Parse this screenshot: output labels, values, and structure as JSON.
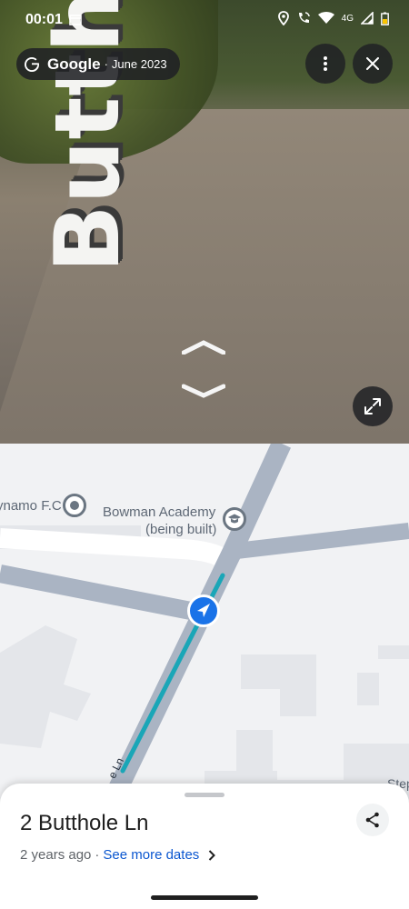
{
  "status_bar": {
    "time": "00:01",
    "network": "4G"
  },
  "street_view": {
    "brand": "Google",
    "separator": "·",
    "capture_date": "June 2023",
    "road_marking": "Butthole Ln"
  },
  "map": {
    "poi_1_label": "ynamo F.C",
    "poi_2_label_line1": "Bowman Academy",
    "poi_2_label_line2": "(being built)",
    "road_label": "e Ln",
    "edge_label": "Step"
  },
  "sheet": {
    "address": "2 Butthole Ln",
    "age": "2 years ago",
    "separator": "·",
    "see_more_label": "See more dates"
  },
  "colors": {
    "road": "#aab4c3",
    "route": "#1aa6b7",
    "nav_arrow": "#1a73e8",
    "link": "#0b57d0"
  }
}
